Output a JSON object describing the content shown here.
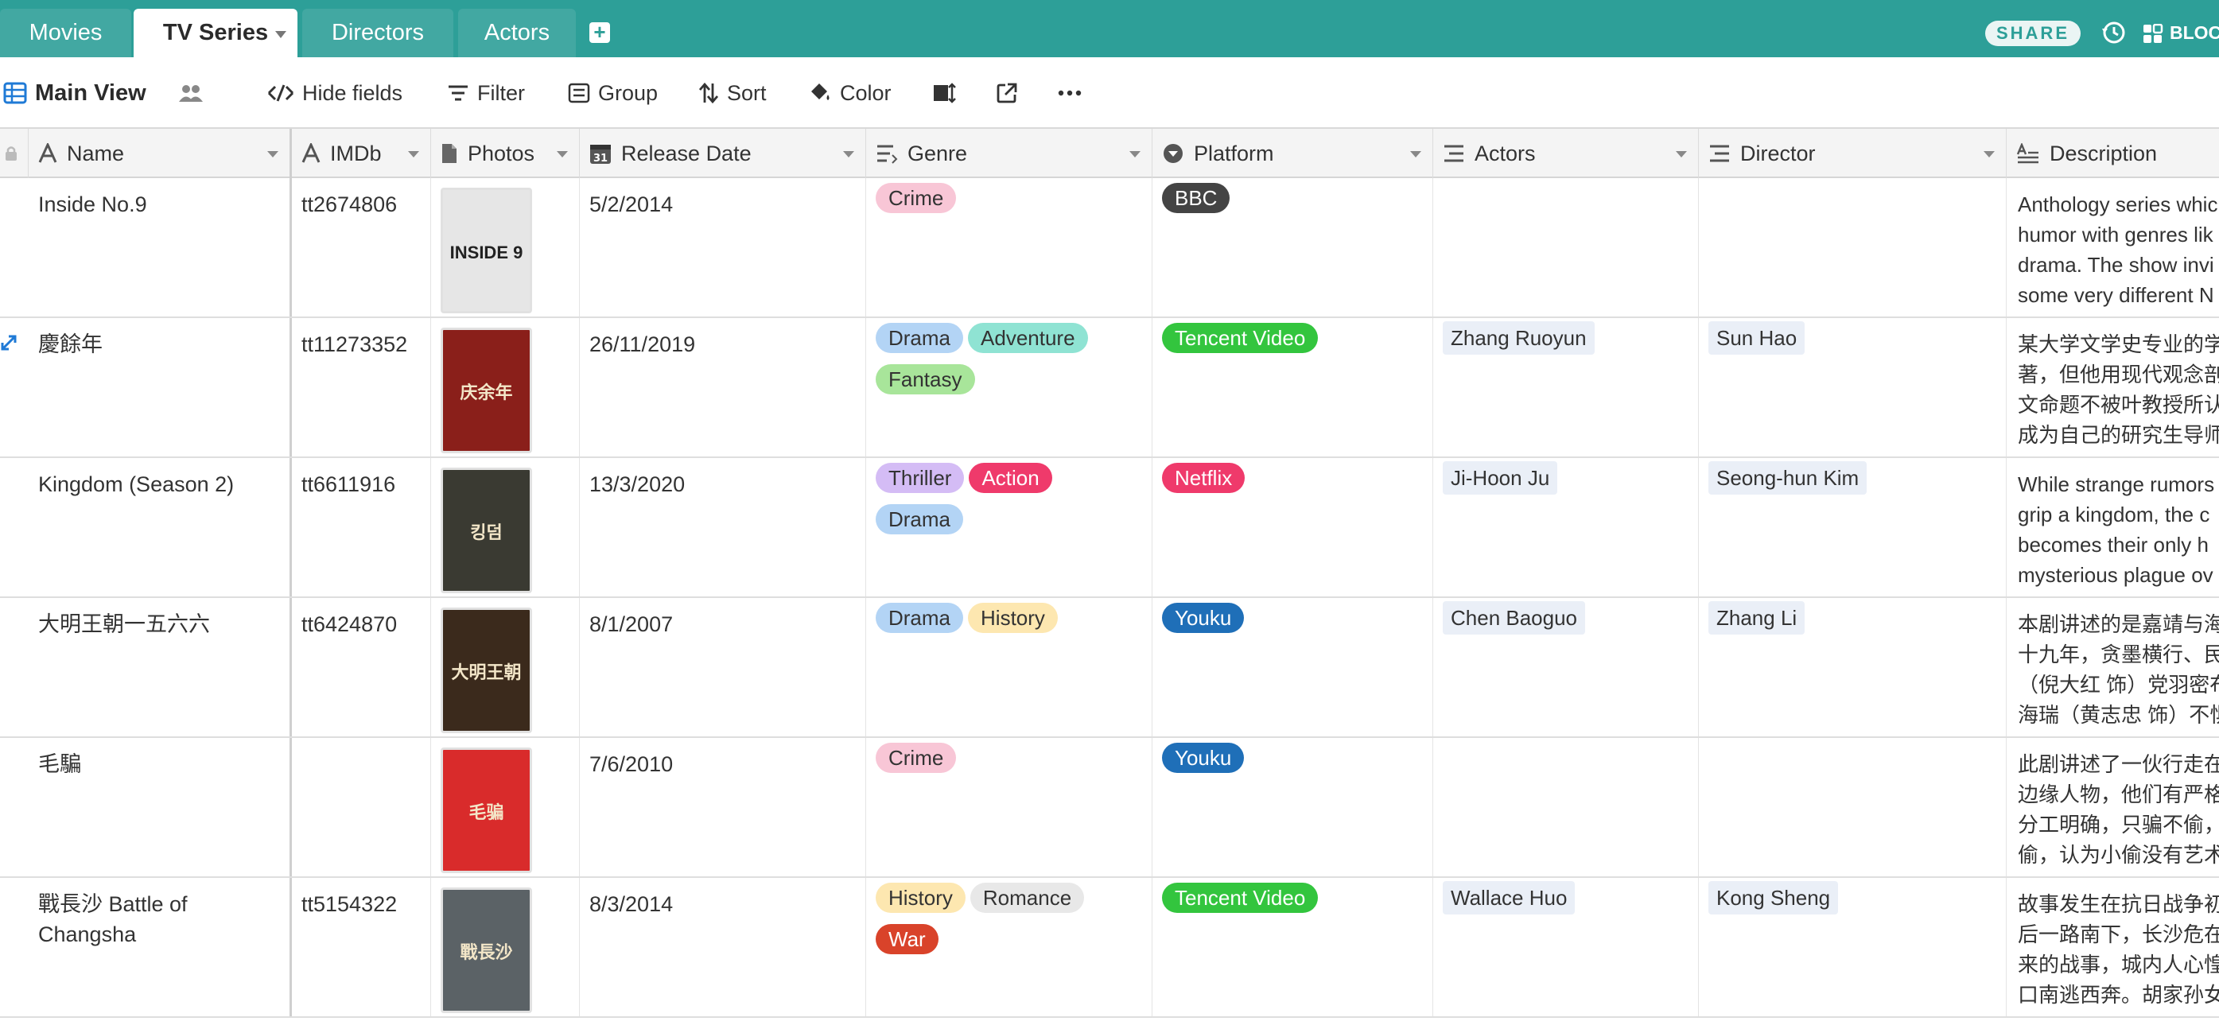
{
  "tabs": [
    {
      "label": "Movies"
    },
    {
      "label": "TV Series"
    },
    {
      "label": "Directors"
    },
    {
      "label": "Actors"
    }
  ],
  "topbar": {
    "share_label": "SHARE",
    "blocks_label": "BLOC"
  },
  "toolbar": {
    "view_name": "Main View",
    "hide_fields": "Hide fields",
    "filter": "Filter",
    "group": "Group",
    "sort": "Sort",
    "color": "Color"
  },
  "columns": {
    "name": "Name",
    "imdb": "IMDb",
    "photos": "Photos",
    "release": "Release Date",
    "genre": "Genre",
    "platform": "Platform",
    "actors": "Actors",
    "director": "Director",
    "description": "Description"
  },
  "colors": {
    "accent": "#2d9f98"
  },
  "rows": [
    {
      "name": [
        "Inside No.9",
        ""
      ],
      "imdb": "tt2674806",
      "release": "5/2/2014",
      "genres": [
        {
          "label": "Crime",
          "bg": "#f8c6d6",
          "fg": "#333"
        }
      ],
      "platform": {
        "label": "BBC",
        "bg": "#444444",
        "fg": "#ffffff"
      },
      "actor": "",
      "director": "",
      "desc": [
        "Anthology series whic",
        "humor with genres lik",
        "drama. The show invi",
        "some very different N"
      ],
      "poster_bg": "#e6e6e6",
      "poster_text": "INSIDE 9"
    },
    {
      "name": [
        "慶餘年",
        ""
      ],
      "imdb": "tt11273352",
      "release": "26/11/2019",
      "genres": [
        {
          "label": "Drama",
          "bg": "#b3d4f5",
          "fg": "#333"
        },
        {
          "label": "Adventure",
          "bg": "#8fe3d3",
          "fg": "#333"
        },
        {
          "label": "Fantasy",
          "bg": "#a8e59a",
          "fg": "#333"
        }
      ],
      "platform": {
        "label": "Tencent Video",
        "bg": "#33c53e",
        "fg": "#ffffff"
      },
      "actor": "Zhang Ruoyun",
      "director": "Sun Hao",
      "desc": [
        "某大学文学史专业的学",
        "著，但他用现代观念剖",
        "文命题不被叶教授所认",
        "成为自己的研究生导师"
      ],
      "poster_bg": "#8a1f1a",
      "poster_text": "庆余年"
    },
    {
      "name": [
        "Kingdom (Season 2)",
        ""
      ],
      "imdb": "tt6611916",
      "release": "13/3/2020",
      "genres": [
        {
          "label": "Thriller",
          "bg": "#d4bcf5",
          "fg": "#333"
        },
        {
          "label": "Action",
          "bg": "#ef3a6b",
          "fg": "#ffffff"
        },
        {
          "label": "Drama",
          "bg": "#b3d4f5",
          "fg": "#333"
        }
      ],
      "platform": {
        "label": "Netflix",
        "bg": "#ef3a6b",
        "fg": "#ffffff"
      },
      "actor": "Ji-Hoon Ju",
      "director": "Seong-hun Kim",
      "desc": [
        "While strange rumors",
        "grip a kingdom, the c",
        "becomes their only h",
        "mysterious plague ov"
      ],
      "poster_bg": "#3a3a32",
      "poster_text": "킹덤"
    },
    {
      "name": [
        "大明王朝一五六六",
        ""
      ],
      "imdb": "tt6424870",
      "release": "8/1/2007",
      "genres": [
        {
          "label": "Drama",
          "bg": "#b3d4f5",
          "fg": "#333"
        },
        {
          "label": "History",
          "bg": "#fde7b0",
          "fg": "#333"
        }
      ],
      "platform": {
        "label": "Youku",
        "bg": "#1f6fb8",
        "fg": "#ffffff"
      },
      "actor": "Chen Baoguo",
      "director": "Zhang Li",
      "desc": [
        "本剧讲述的是嘉靖与海",
        "十九年，贪墨横行、民",
        "（倪大红 饰）党羽密布",
        "海瑞（黄志忠 饰）不惧"
      ],
      "poster_bg": "#3b2a1c",
      "poster_text": "大明王朝"
    },
    {
      "name": [
        "毛騙",
        ""
      ],
      "imdb": "",
      "release": "7/6/2010",
      "genres": [
        {
          "label": "Crime",
          "bg": "#f8c6d6",
          "fg": "#333"
        }
      ],
      "platform": {
        "label": "Youku",
        "bg": "#1f6fb8",
        "fg": "#ffffff"
      },
      "actor": "",
      "director": "",
      "desc": [
        "此剧讲述了一伙行走在",
        "边缘人物，他们有严格",
        "分工明确，只骗不偷，",
        "偷，认为小偷没有艺术"
      ],
      "poster_bg": "#d92b2b",
      "poster_text": "毛骗"
    },
    {
      "name": [
        "戰長沙 Battle of",
        "Changsha"
      ],
      "imdb": "tt5154322",
      "release": "8/3/2014",
      "genres": [
        {
          "label": "History",
          "bg": "#fde7b0",
          "fg": "#333"
        },
        {
          "label": "Romance",
          "bg": "#e8e8e8",
          "fg": "#333"
        },
        {
          "label": "War",
          "bg": "#d9432a",
          "fg": "#ffffff"
        }
      ],
      "platform": {
        "label": "Tencent Video",
        "bg": "#33c53e",
        "fg": "#ffffff"
      },
      "actor": "Wallace Huo",
      "director": "Kong Sheng",
      "desc": [
        "故事发生在抗日战争初",
        "后一路南下，长沙危在",
        "来的战事，城内人心惶",
        "口南逃西奔。胡家孙女"
      ],
      "poster_bg": "#5b6266",
      "poster_text": "戰長沙"
    }
  ]
}
